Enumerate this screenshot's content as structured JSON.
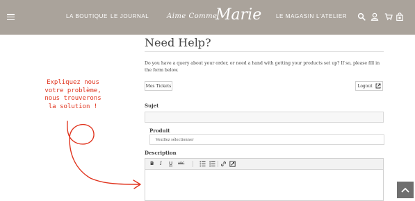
{
  "header": {
    "menu_icon": "hamburger-icon",
    "nav_left": [
      "LA BOUTIQUE",
      "LE JOURNAL"
    ],
    "logo": {
      "script": "Aime Comme",
      "big": "Marie"
    },
    "nav_right": [
      "LE MAGASIN",
      "L'ATELIER"
    ],
    "icons": [
      "search-icon",
      "user-icon",
      "cart-icon",
      "bag-icon"
    ],
    "background": "#aaa39b"
  },
  "main": {
    "title": "Need Help?",
    "intro": "Do you have a query about your order, or need a hand with getting your products set up? If so, please fill in the form below.",
    "tickets_button": "Mes Tickets",
    "logout_button": "Logout",
    "subject_label": "Sujet",
    "product_label": "Produit",
    "product_select": "Veuillez sélectionner",
    "description_label": "Description",
    "toolbar": [
      "B",
      "I",
      "U",
      "ABC"
    ]
  },
  "annotation": {
    "lines": [
      "Expliquez nous",
      "votre problème,",
      "nous trouverons",
      "la solution !"
    ],
    "color": "#e0341e"
  }
}
